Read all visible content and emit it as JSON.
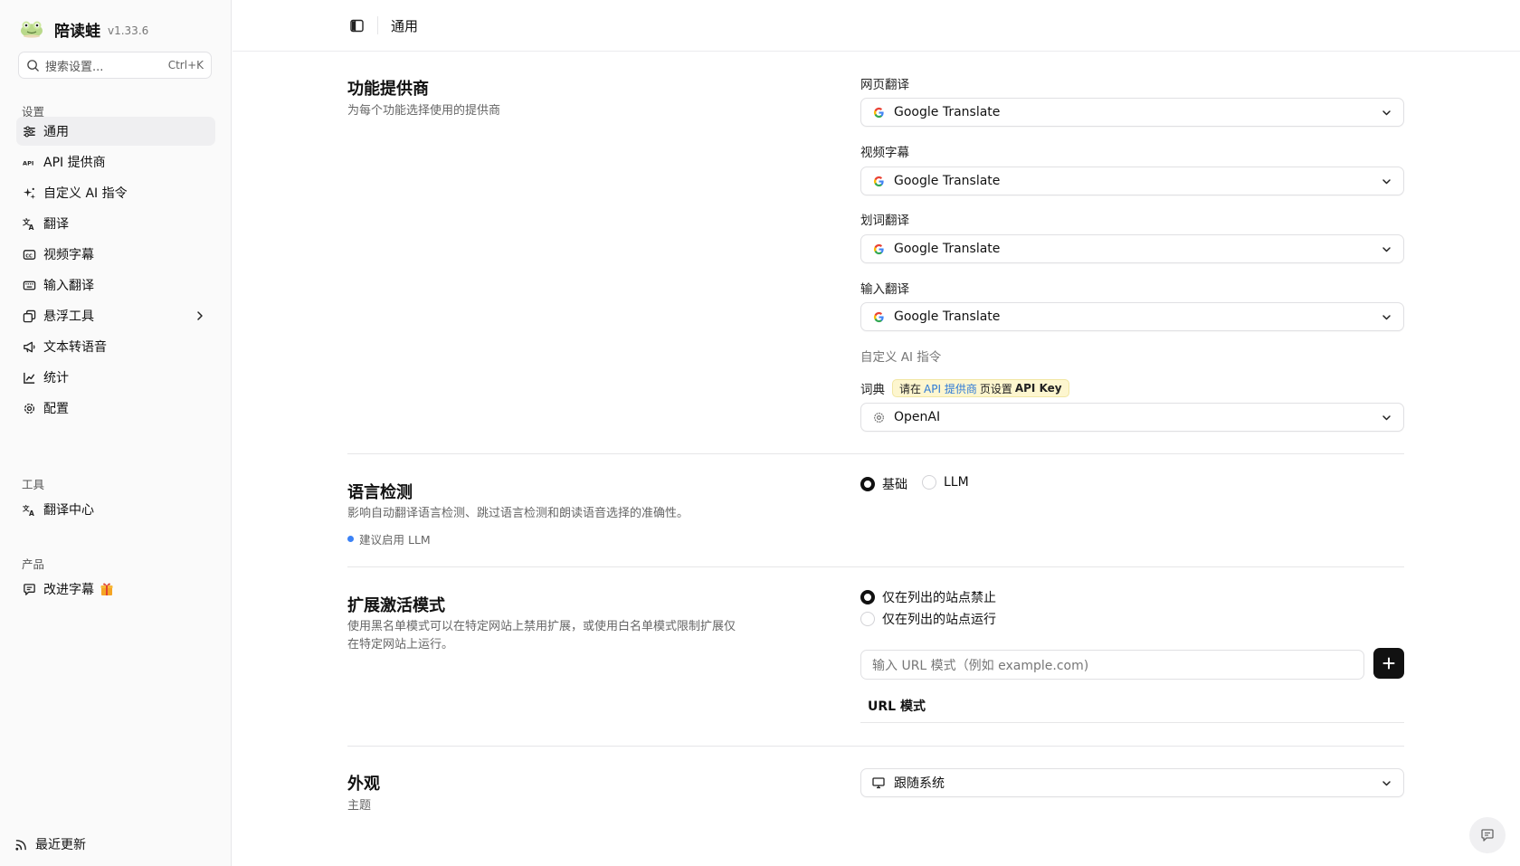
{
  "app": {
    "name": "陪读蛙",
    "version": "v1.33.6"
  },
  "search": {
    "placeholder": "搜索设置...",
    "shortcut": "Ctrl+K"
  },
  "sidebar": {
    "settings_label": "设置",
    "settings_items": [
      {
        "label": "通用",
        "icon": "sliders-icon",
        "active": true
      },
      {
        "label": "API 提供商",
        "icon": "api-icon"
      },
      {
        "label": "自定义 AI 指令",
        "icon": "sparkles-icon"
      },
      {
        "label": "翻译",
        "icon": "translate-icon"
      },
      {
        "label": "视频字幕",
        "icon": "subtitles-icon"
      },
      {
        "label": "输入翻译",
        "icon": "keyboard-icon"
      },
      {
        "label": "悬浮工具",
        "icon": "layers-icon",
        "has_submenu": true
      },
      {
        "label": "文本转语音",
        "icon": "megaphone-icon"
      },
      {
        "label": "统计",
        "icon": "chart-icon"
      },
      {
        "label": "配置",
        "icon": "gear-icon"
      }
    ],
    "tools_label": "工具",
    "tools_items": [
      {
        "label": "翻译中心",
        "icon": "translate-hub-icon"
      }
    ],
    "product_label": "产品",
    "product_items": [
      {
        "label": "改进字幕",
        "icon": "feedback-icon",
        "badge_icon": "gift-icon"
      }
    ],
    "footer": {
      "label": "最近更新",
      "icon": "rss-icon"
    }
  },
  "header": {
    "breadcrumb": "通用"
  },
  "sections": {
    "providers": {
      "title": "功能提供商",
      "description": "为每个功能选择使用的提供商",
      "fields": [
        {
          "label": "网页翻译",
          "value": "Google Translate"
        },
        {
          "label": "视频字幕",
          "value": "Google Translate"
        },
        {
          "label": "划词翻译",
          "value": "Google Translate"
        },
        {
          "label": "输入翻译",
          "value": "Google Translate"
        }
      ],
      "custom_ai_label": "自定义 AI 指令",
      "dictionary": {
        "label": "词典",
        "badge_prefix": "请在",
        "badge_link": "API 提供商",
        "badge_middle": "页设置",
        "badge_bold": "API Key",
        "value": "OpenAI"
      }
    },
    "language_detection": {
      "title": "语言检测",
      "description": "影响自动翻译语言检测、跳过语言检测和朗读语音选择的准确性。",
      "tip": "建议启用 LLM",
      "options": [
        {
          "label": "基础",
          "selected": true
        },
        {
          "label": "LLM",
          "selected": false
        }
      ]
    },
    "activation": {
      "title": "扩展激活模式",
      "description_line1": "使用黑名单模式可以在特定网站上禁用扩展，或使用白名单模式限制扩展仅",
      "description_line2": "在特定网站上运行。",
      "options": [
        {
          "label": "仅在列出的站点禁止",
          "selected": true
        },
        {
          "label": "仅在列出的站点运行",
          "selected": false
        }
      ],
      "url_placeholder": "输入 URL 模式（例如 example.com)",
      "table_header": "URL 模式"
    },
    "appearance": {
      "title": "外观",
      "description": "主题",
      "value": "跟随系统"
    }
  },
  "colors": {
    "accent": "#111111",
    "link": "#2e7ad6",
    "badge_bg": "#fdf6cf",
    "tip_dot": "#3b82f6"
  }
}
